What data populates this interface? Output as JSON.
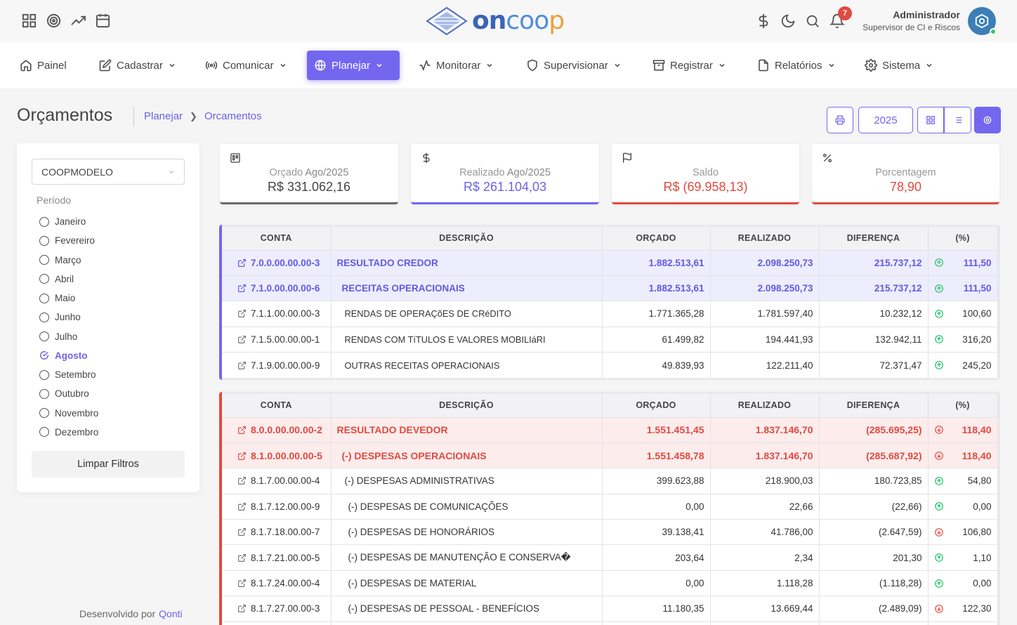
{
  "brand": {
    "logo_on": "on",
    "logo_coo": "coo",
    "logo_p": "p"
  },
  "user": {
    "name": "Administrador",
    "role": "Supervisor de CI e Riscos",
    "notifications": "7"
  },
  "nav": [
    {
      "label": "Painel",
      "icon": "home-icon"
    },
    {
      "label": "Cadastrar",
      "icon": "edit-icon"
    },
    {
      "label": "Comunicar",
      "icon": "broadcast-icon"
    },
    {
      "label": "Planejar",
      "icon": "globe-icon",
      "active": true
    },
    {
      "label": "Monitorar",
      "icon": "activity-icon"
    },
    {
      "label": "Supervisionar",
      "icon": "shield-icon"
    },
    {
      "label": "Registrar",
      "icon": "archive-icon"
    },
    {
      "label": "Relatórios",
      "icon": "file-icon"
    },
    {
      "label": "Sistema",
      "icon": "gear-icon"
    }
  ],
  "page": {
    "title": "Orçamentos",
    "breadcrumb_parent": "Planejar",
    "breadcrumb_current": "Orcamentos",
    "year": "2025"
  },
  "filters": {
    "cooperative": "COOPMODELO",
    "period_label": "Período",
    "months": [
      "Janeiro",
      "Fevereiro",
      "Março",
      "Abril",
      "Maio",
      "Junho",
      "Julho",
      "Agosto",
      "Setembro",
      "Outubro",
      "Novembro",
      "Dezembro"
    ],
    "selected_month": "Agosto",
    "clear_label": "Limpar Filtros"
  },
  "footer": {
    "dev_label": "Desenvolvido por",
    "dev_link": "Qonti"
  },
  "cards": {
    "orcado": {
      "label": "Orçado",
      "period": "Ago/2025",
      "value": "R$ 331.062,16"
    },
    "realizado": {
      "label": "Realizado",
      "period": "Ago/2025",
      "value": "R$ 261.104,03"
    },
    "saldo": {
      "label": "Saldo",
      "value": "R$ (69.958,13)"
    },
    "porcentagem": {
      "label": "Porcentagem",
      "value": "78,90"
    }
  },
  "table_headers": {
    "conta": "CONTA",
    "descricao": "DESCRIÇÃO",
    "orcado": "ORÇADO",
    "realizado": "REALIZADO",
    "diferenca": "DIFERENÇA",
    "pct": "(%)"
  },
  "credor": [
    {
      "conta": "7.0.0.00.00.00-3",
      "desc": "RESULTADO CREDOR",
      "orcado": "1.882.513,61",
      "realizado": "2.098.250,73",
      "dif": "215.737,12",
      "pct": "111,50",
      "dir": "up",
      "hl": true,
      "indent": 0
    },
    {
      "conta": "7.1.0.00.00.00-6",
      "desc": "RECEITAS OPERACIONAIS",
      "orcado": "1.882.513,61",
      "realizado": "2.098.250,73",
      "dif": "215.737,12",
      "pct": "111,50",
      "dir": "up",
      "hl": true,
      "indent": 1
    },
    {
      "conta": "7.1.1.00.00.00-3",
      "desc": "RENDAS DE OPERAÇõES DE CRéDITO",
      "orcado": "1.771.365,28",
      "realizado": "1.781.597,40",
      "dif": "10.232,12",
      "pct": "100,60",
      "dir": "up",
      "hl": false,
      "indent": 2
    },
    {
      "conta": "7.1.5.00.00.00-1",
      "desc": "RENDAS COM TíTULOS E VALORES MOBILIáRI",
      "orcado": "61.499,82",
      "realizado": "194.441,93",
      "dif": "132.942,11",
      "pct": "316,20",
      "dir": "up",
      "hl": false,
      "indent": 2
    },
    {
      "conta": "7.1.9.00.00.00-9",
      "desc": "OUTRAS RECEITAS OPERACIONAIS",
      "orcado": "49.839,93",
      "realizado": "122.211,40",
      "dif": "72.371,47",
      "pct": "245,20",
      "dir": "up",
      "hl": false,
      "indent": 2
    }
  ],
  "devedor": [
    {
      "conta": "8.0.0.00.00.00-2",
      "desc": "RESULTADO DEVEDOR",
      "orcado": "1.551.451,45",
      "realizado": "1.837.146,70",
      "dif": "(285.695,25)",
      "pct": "118,40",
      "dir": "down",
      "hl": true,
      "indent": 0
    },
    {
      "conta": "8.1.0.00.00.00-5",
      "desc": "(-) DESPESAS OPERACIONAIS",
      "orcado": "1.551.458,78",
      "realizado": "1.837.146,70",
      "dif": "(285.687,92)",
      "pct": "118,40",
      "dir": "down",
      "hl": true,
      "indent": 1
    },
    {
      "conta": "8.1.7.00.00.00-4",
      "desc": "(-) DESPESAS ADMINISTRATIVAS",
      "orcado": "399.623,88",
      "realizado": "218.900,03",
      "dif": "180.723,85",
      "pct": "54,80",
      "dir": "up",
      "hl": false,
      "indent": 2
    },
    {
      "conta": "8.1.7.12.00.00-9",
      "desc": "(-) DESPESAS DE COMUNICAÇÕES",
      "orcado": "0,00",
      "realizado": "22,66",
      "dif": "(22,66)",
      "pct": "0,00",
      "dir": "up",
      "hl": false,
      "indent": 3
    },
    {
      "conta": "8.1.7.18.00.00-7",
      "desc": "(-) DESPESAS DE HONORÁRIOS",
      "orcado": "39.138,41",
      "realizado": "41.786,00",
      "dif": "(2.647,59)",
      "pct": "106,80",
      "dir": "down",
      "hl": false,
      "indent": 3
    },
    {
      "conta": "8.1.7.21.00.00-5",
      "desc": "(-) DESPESAS DE MANUTENÇÃO E CONSERVA�",
      "orcado": "203,64",
      "realizado": "2,34",
      "dif": "201,30",
      "pct": "1,10",
      "dir": "up",
      "hl": false,
      "indent": 3
    },
    {
      "conta": "8.1.7.24.00.00-4",
      "desc": "(-) DESPESAS DE MATERIAL",
      "orcado": "0,00",
      "realizado": "1.118,28",
      "dif": "(1.118,28)",
      "pct": "0,00",
      "dir": "up",
      "hl": false,
      "indent": 3
    },
    {
      "conta": "8.1.7.27.00.00-3",
      "desc": "(-) DESPESAS DE PESSOAL - BENEFÍCIOS",
      "orcado": "11.180,35",
      "realizado": "13.669,44",
      "dif": "(2.489,09)",
      "pct": "122,30",
      "dir": "down",
      "hl": false,
      "indent": 3
    },
    {
      "conta": "",
      "desc": "",
      "orcado": "",
      "realizado": "",
      "dif": "",
      "pct": "",
      "dir": "",
      "hl": false,
      "indent": 3
    }
  ]
}
